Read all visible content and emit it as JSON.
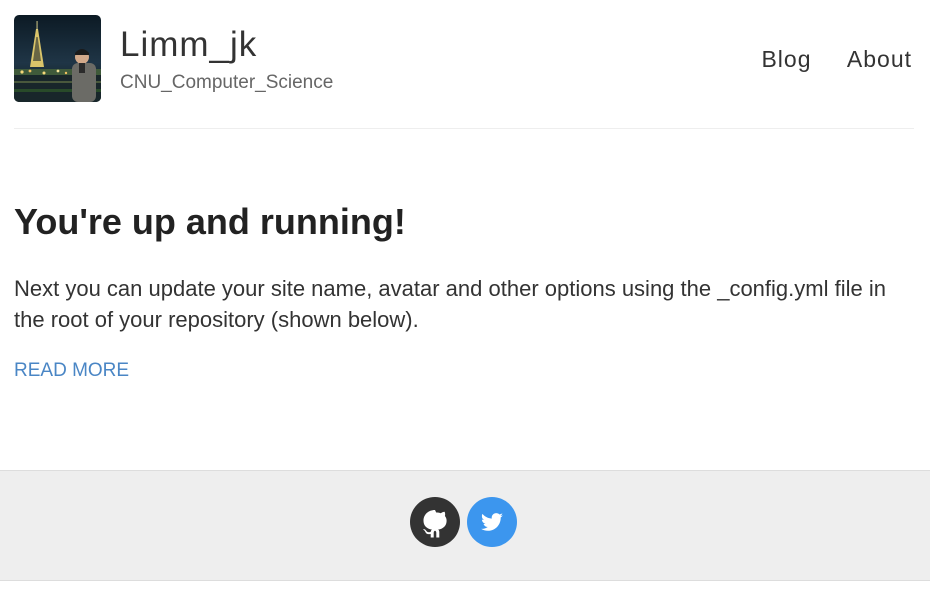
{
  "header": {
    "site_title": "Limm_jk",
    "site_description": "CNU_Computer_Science",
    "avatar_icon": "avatar-photo",
    "nav": [
      {
        "label": "Blog"
      },
      {
        "label": "About"
      }
    ]
  },
  "main": {
    "post": {
      "title": "You're up and running!",
      "excerpt": "Next you can update your site name, avatar and other options using the _config.yml file in the root of your repository (shown below).",
      "read_more_label": "READ MORE"
    }
  },
  "footer": {
    "social": [
      {
        "icon": "github-icon",
        "color": "#333333"
      },
      {
        "icon": "twitter-icon",
        "color": "#3c96ee"
      }
    ]
  },
  "colors": {
    "link": "#4a86c5",
    "footer_bg": "#eeeeee",
    "text": "#222222"
  }
}
